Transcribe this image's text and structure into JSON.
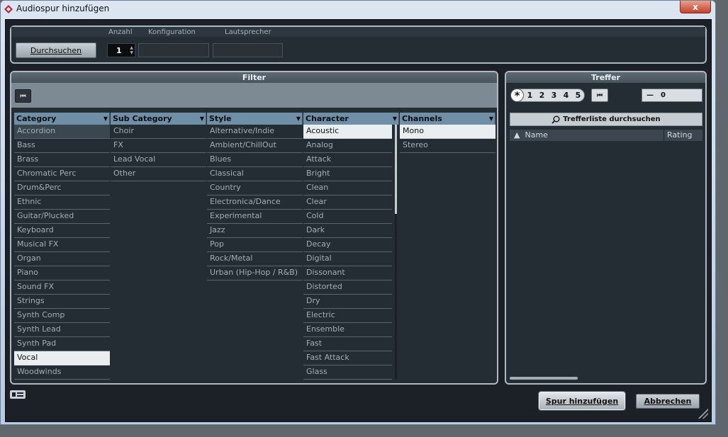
{
  "window": {
    "title": "Audiospur hinzufügen",
    "close_label": "x"
  },
  "top": {
    "labels": {
      "count": "Anzahl",
      "config": "Konfiguration",
      "speakers": "Lautsprecher"
    },
    "browse_label": "Durchsuchen",
    "count_value": "1"
  },
  "filter": {
    "title": "Filter",
    "rewind_label": "⏮",
    "columns": {
      "category": {
        "header": "Category",
        "items": [
          "Accordion",
          "Bass",
          "Brass",
          "Chromatic Perc",
          "Drum&Perc",
          "Ethnic",
          "Guitar/Plucked",
          "Keyboard",
          "Musical FX",
          "Organ",
          "Piano",
          "Sound FX",
          "Strings",
          "Synth Comp",
          "Synth Lead",
          "Synth Pad",
          "Vocal",
          "Woodwinds"
        ],
        "selected": "Vocal"
      },
      "subcategory": {
        "header": "Sub Category",
        "items": [
          "Choir",
          "FX",
          "Lead Vocal",
          "Other"
        ]
      },
      "style": {
        "header": "Style",
        "items": [
          "Alternative/Indie",
          "Ambient/ChillOut",
          "Blues",
          "Classical",
          "Country",
          "Electronica/Dance",
          "Experimental",
          "Jazz",
          "Pop",
          "Rock/Metal",
          "Urban (Hip-Hop / R&B)"
        ]
      },
      "character": {
        "header": "Character",
        "items": [
          "Acoustic",
          "Analog",
          "Attack",
          "Bright",
          "Clean",
          "Clear",
          "Cold",
          "Dark",
          "Decay",
          "Digital",
          "Dissonant",
          "Distorted",
          "Dry",
          "Electric",
          "Ensemble",
          "Fast",
          "Fast Attack",
          "Glass"
        ],
        "selected": "Acoustic"
      },
      "channels": {
        "header": "Channels",
        "items": [
          "Mono",
          "Stereo"
        ],
        "selected": "Mono"
      }
    }
  },
  "results": {
    "title": "Treffer",
    "star": "*",
    "ratings": [
      "1",
      "2",
      "3",
      "4",
      "5"
    ],
    "rewind_label": "⏮",
    "count_minus": "—",
    "count_value": "0",
    "search_label": "Trefferliste durchsuchen",
    "columns": {
      "name": "Name",
      "rating": "Rating"
    }
  },
  "buttons": {
    "add": "Spur hinzufügen",
    "cancel": "Abbrechen"
  }
}
